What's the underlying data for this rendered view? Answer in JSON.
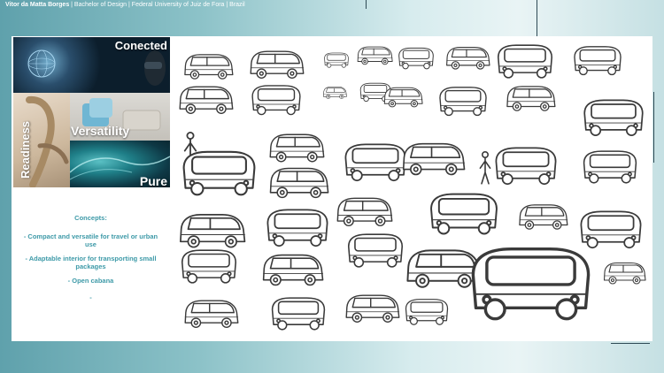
{
  "header": {
    "author": "Vitor da Matta Borges",
    "details": "| Bachelor of Design | Federal University of Juiz de Fora | Brazil"
  },
  "moodboard": {
    "words": {
      "connected": "Conected",
      "versatility": "Versatility",
      "readiness": "Readiness",
      "pure": "Pure"
    }
  },
  "concepts": {
    "title": "Concepts:",
    "items": [
      "- Compact and versatile for travel or urban use",
      "- Adaptable interior for transporting small packages",
      "- Open cabana"
    ],
    "trailing": "-"
  },
  "colors": {
    "accent": "#3e9aa8",
    "background": "#8cc2c8",
    "board": "#ffffff",
    "sketch_line": "#3a3a3a"
  }
}
